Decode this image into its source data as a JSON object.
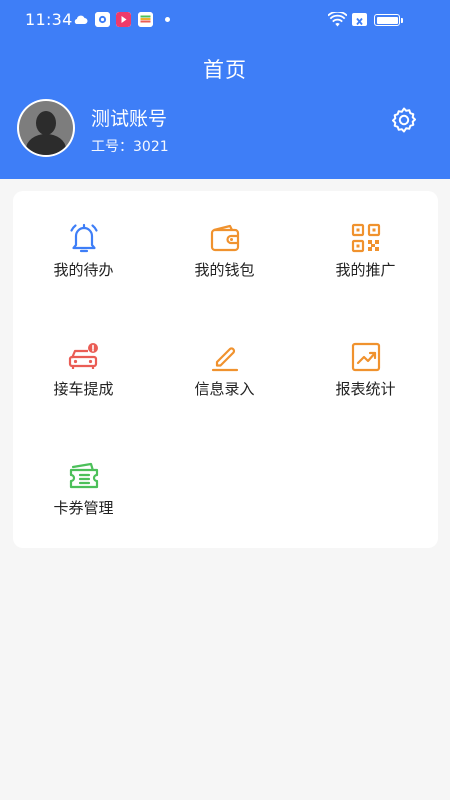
{
  "status_bar": {
    "time": "11:34",
    "icons": [
      "cloud-icon",
      "camera-app-icon",
      "video-app-icon",
      "wallet-app-icon",
      "dot-icon",
      "wifi-icon",
      "sim-off-icon",
      "battery-icon"
    ]
  },
  "header": {
    "title": "首页",
    "background": "#3e7ef7"
  },
  "profile": {
    "name": "测试账号",
    "employee_id": "工号：3021"
  },
  "menu": {
    "items": [
      {
        "label": "我的待办",
        "icon": "bell-icon",
        "color": "#3e7ef7"
      },
      {
        "label": "我的钱包",
        "icon": "wallet-icon",
        "color": "#f0922e"
      },
      {
        "label": "我的推广",
        "icon": "qrcode-icon",
        "color": "#f0922e"
      },
      {
        "label": "接车提成",
        "icon": "car-icon",
        "color": "#ea5d55"
      },
      {
        "label": "信息录入",
        "icon": "edit-icon",
        "color": "#f0922e"
      },
      {
        "label": "报表统计",
        "icon": "chart-icon",
        "color": "#f0922e"
      },
      {
        "label": "卡券管理",
        "icon": "ticket-icon",
        "color": "#4cc05a"
      }
    ]
  }
}
